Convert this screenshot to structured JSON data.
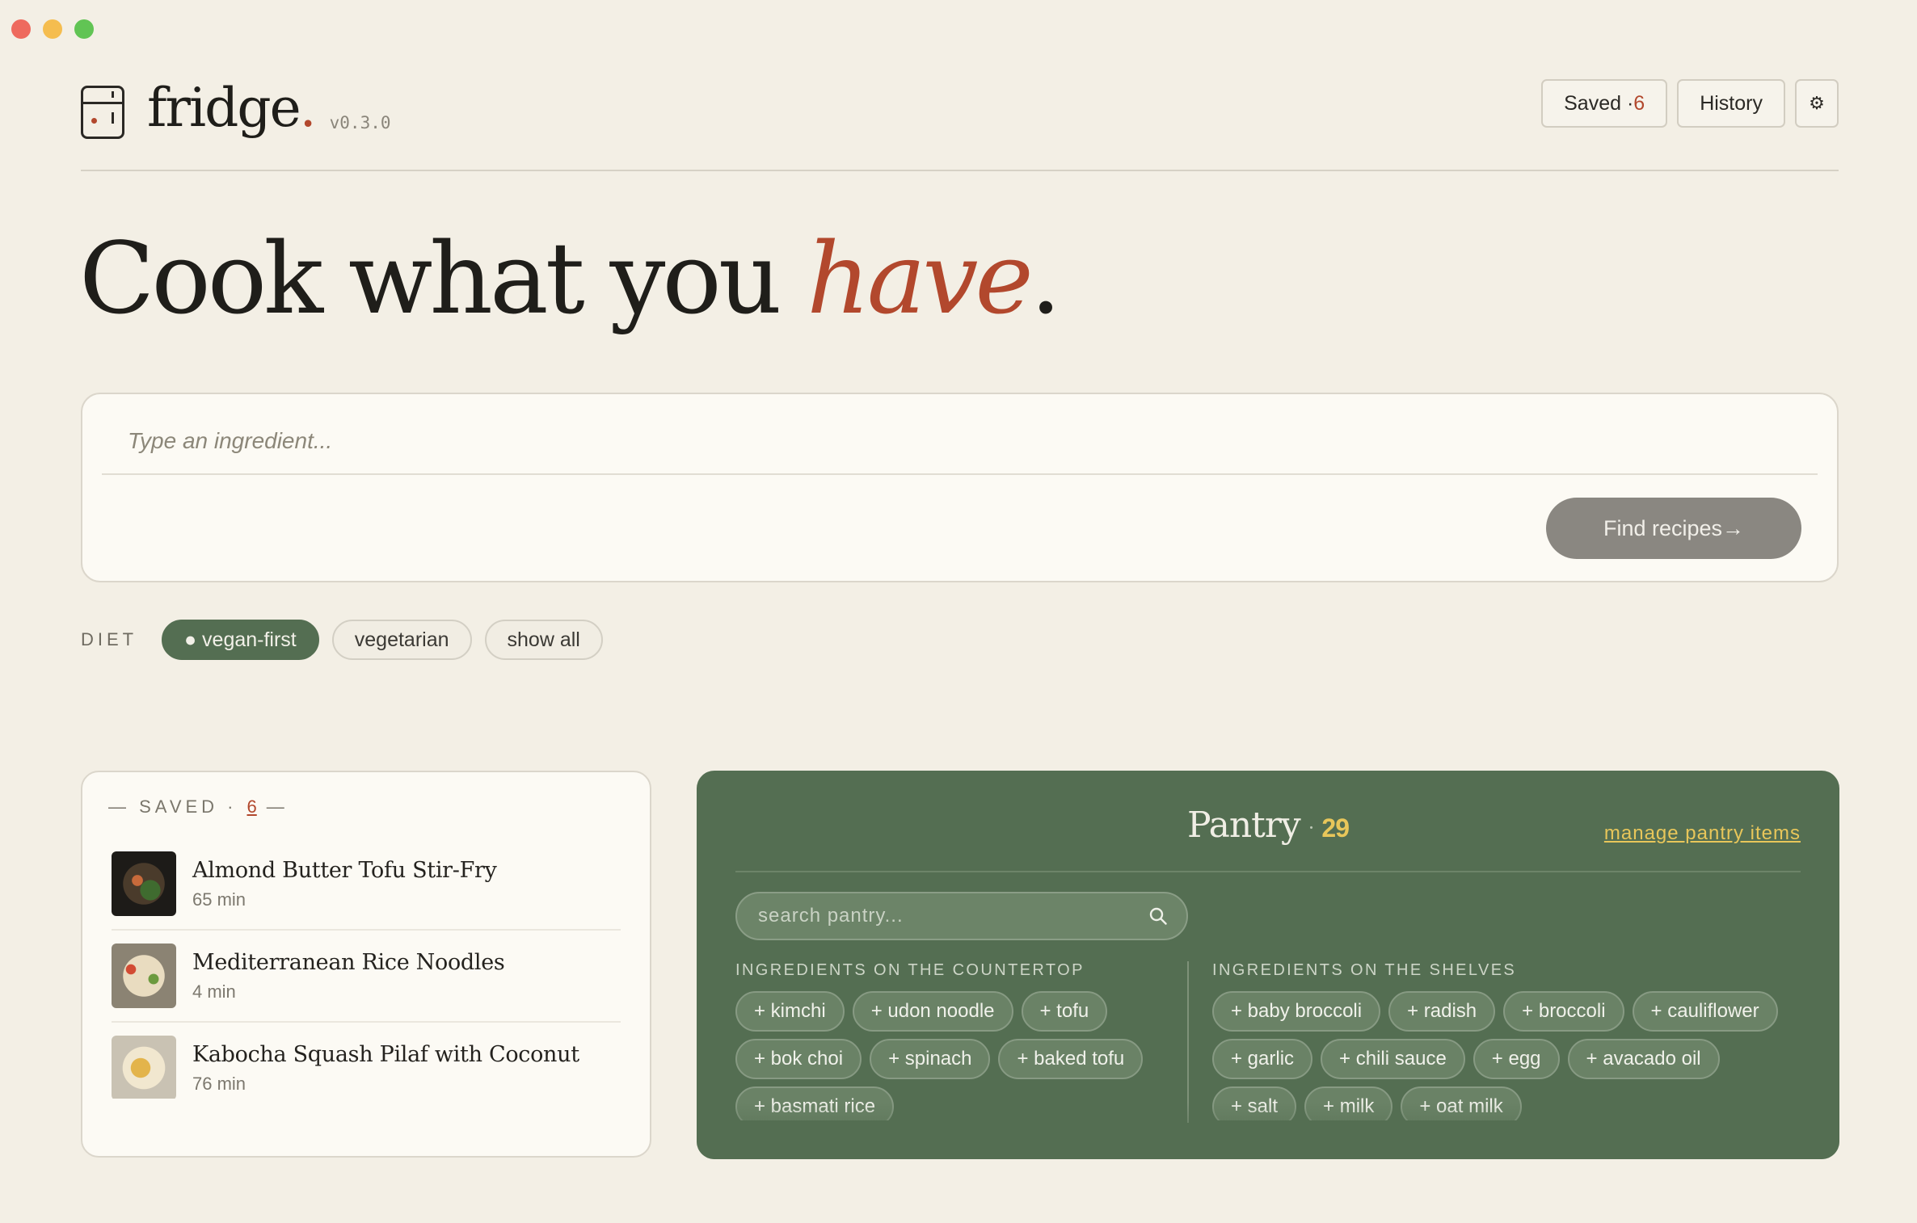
{
  "colors": {
    "background": "#f3efe5",
    "accent": "#b2482d",
    "pantry_green": "#546e52",
    "highlight_yellow": "#e8c65a"
  },
  "brand": {
    "name": "fridge",
    "dot": ".",
    "version": "v0.3.0",
    "icon": "fridge-icon"
  },
  "header": {
    "saved_label": "Saved · ",
    "saved_count": "6",
    "history_label": "History",
    "settings_icon": "⚙"
  },
  "hero": {
    "before": "Cook what you ",
    "accent": "have",
    "after": "."
  },
  "search": {
    "placeholder": "Type an ingredient...",
    "value": "",
    "button_label": "Find recipes→"
  },
  "diet": {
    "label": "DIET",
    "options": [
      "● vegan-first",
      "vegetarian",
      "show all"
    ],
    "selected": "● vegan-first"
  },
  "saved": {
    "heading": "— SAVED ·",
    "count": "6",
    "heading_end": "—",
    "items": [
      {
        "title": "Almond Butter Tofu Stir-Fry",
        "time": "65 min"
      },
      {
        "title": "Mediterranean Rice Noodles",
        "time": "4 min"
      },
      {
        "title": "Kabocha Squash Pilaf with Coconut",
        "time": "76 min"
      },
      {
        "title": "",
        "time": ""
      }
    ]
  },
  "pantry": {
    "title": "Pantry",
    "separator": "·",
    "count": "29",
    "manage_label": "manage pantry items",
    "search_placeholder": "search pantry...",
    "countertop_title": "INGREDIENTS ON THE COUNTERTOP",
    "countertop": [
      "+ kimchi",
      "+ udon noodle",
      "+ tofu",
      "+ bok choi",
      "+ spinach",
      "+ baked tofu",
      "+ basmati rice"
    ],
    "shelves_title": "INGREDIENTS ON THE SHELVES",
    "shelves": [
      "+ baby broccoli",
      "+ radish",
      "+ broccoli",
      "+ cauliflower",
      "+ garlic",
      "+ chili sauce",
      "+ egg",
      "+ avacado oil",
      "+ salt",
      "+ milk",
      "+ oat milk"
    ]
  }
}
